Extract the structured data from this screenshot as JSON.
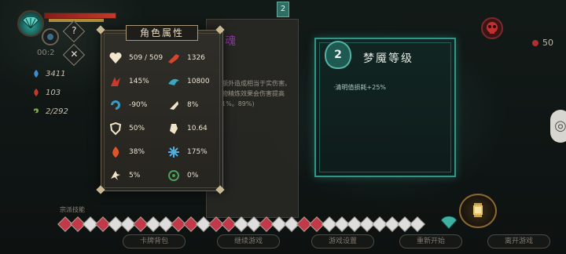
{
  "hud": {
    "timer": "00:2",
    "stats": [
      {
        "icon": "blue-flame-icon",
        "value": "3411"
      },
      {
        "icon": "red-flame-icon",
        "value": "103"
      },
      {
        "icon": "green-soul-icon",
        "value": "2/292"
      }
    ],
    "help_label": "?",
    "close_label": "✕"
  },
  "center_panel": {
    "badge": "2",
    "title_fragment": "魂",
    "description": "额外造成相当于实伤害。物精炼效果会伤害提高1%。89%)"
  },
  "attributes": {
    "title": "角色属性",
    "items": [
      {
        "icon": "heart-icon",
        "value": "509 / 509"
      },
      {
        "icon": "attack-icon",
        "value": "1326"
      },
      {
        "icon": "crit-claw-icon",
        "value": "145%"
      },
      {
        "icon": "speed-icon",
        "value": "10800"
      },
      {
        "icon": "recovery-icon",
        "value": "-90%"
      },
      {
        "icon": "dodge-icon",
        "value": "8%"
      },
      {
        "icon": "shield-icon",
        "value": "50%"
      },
      {
        "icon": "defense-icon",
        "value": "10.64"
      },
      {
        "icon": "fire-icon",
        "value": "38%"
      },
      {
        "icon": "frost-icon",
        "value": "175%"
      },
      {
        "icon": "movement-icon",
        "value": "5%"
      },
      {
        "icon": "poison-icon",
        "value": "0%"
      }
    ]
  },
  "nightmare_card": {
    "level": "2",
    "title": "梦魇等级",
    "effect": "·清明值损耗+25%"
  },
  "top_right": {
    "kill_count": "50"
  },
  "bottom": {
    "skills_label": "宗派技能",
    "skill_gems": [
      "#c23a4a",
      "#c23a4a",
      "#ddd",
      "#c23a4a",
      "#ddd",
      "#ddd",
      "#c23a4a",
      "#ddd",
      "#ddd",
      "#c23a4a",
      "#c23a4a",
      "#ddd",
      "#c23a4a",
      "#c23a4a",
      "#ddd",
      "#ddd",
      "#c23a4a",
      "#ddd",
      "#ddd",
      "#c23a4a",
      "#c23a4a",
      "#ddd",
      "#ddd",
      "#ddd",
      "#ddd",
      "#ddd",
      "#ddd",
      "#ddd",
      "#ddd"
    ],
    "buttons": [
      "卡牌背包",
      "继续游戏",
      "游戏设置",
      "重新开始",
      "离开游戏"
    ]
  },
  "colors": {
    "teal_accent": "#2f9688",
    "panel_bg": "#2f2e29",
    "gold_trim": "#a89778"
  }
}
